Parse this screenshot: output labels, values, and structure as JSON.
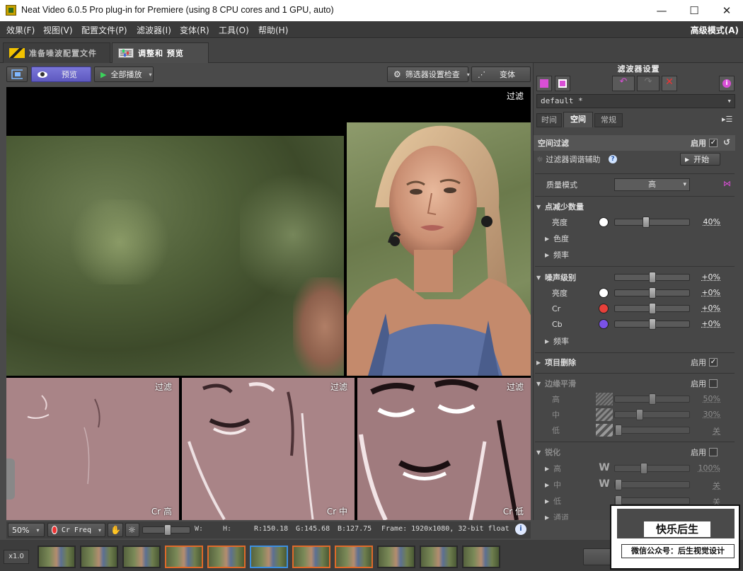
{
  "window": {
    "title": "Neat Video 6.0.5 Pro plug-in for Premiere (using 8 CPU cores and 1 GPU, auto)"
  },
  "menu": {
    "items": [
      "效果(F)",
      "视图(V)",
      "配置文件(P)",
      "滤波器(I)",
      "变体(R)",
      "工具(O)",
      "帮助(H)"
    ],
    "advanced_mode": "高级模式(A)"
  },
  "tabs": [
    {
      "label": "准备噪波配置文件",
      "active": false
    },
    {
      "label": "调整和 预览",
      "active": true
    }
  ],
  "toolbar": {
    "preview_label": "预览",
    "play_all_label": "全部播放",
    "filter_inspect_label": "筛选器设置检查",
    "variant_label": "变体"
  },
  "viewer": {
    "main_label": "过滤",
    "panes": [
      {
        "top": "过滤",
        "bottom": "Cr 高"
      },
      {
        "top": "过滤",
        "bottom": "Cr 中"
      },
      {
        "top": "过滤",
        "bottom": "Cr 低"
      }
    ]
  },
  "filter_panel": {
    "title": "滤波器设置",
    "profile": "default *",
    "subtabs": [
      "时间",
      "空间",
      "常规"
    ],
    "active_subtab": "空间",
    "spatial_filter": {
      "label": "空间过滤",
      "enable_label": "启用",
      "enabled": true
    },
    "assist": {
      "label": "过滤器调谐辅助",
      "button": "开始"
    },
    "quality": {
      "label": "质量模式",
      "value": "高"
    },
    "noise_reduction": {
      "label": "点减少数量",
      "luma": {
        "label": "亮度",
        "value": "40%",
        "level": 40
      },
      "chroma": "色度",
      "frequency": "频率"
    },
    "noise_level": {
      "label": "噪声级别",
      "value": "+0%",
      "rows": [
        {
          "label": "亮度",
          "value": "+0%",
          "color": "#ffffff"
        },
        {
          "label": "Cr",
          "value": "+0%",
          "color": "#e8403a"
        },
        {
          "label": "Cb",
          "value": "+0%",
          "color": "#7a52e8"
        }
      ],
      "frequency": "频率"
    },
    "artifact_removal": {
      "label": "项目删除",
      "enable_label": "启用",
      "enabled": true
    },
    "edge_smoothing": {
      "label": "边缘平滑",
      "enable_label": "启用",
      "enabled": false,
      "rows": [
        {
          "label": "高",
          "value": "50%"
        },
        {
          "label": "中",
          "value": "30%"
        },
        {
          "label": "低",
          "value": "关"
        }
      ]
    },
    "sharpening": {
      "label": "锐化",
      "enable_label": "启用",
      "enabled": false,
      "rows": [
        {
          "label": "高",
          "value": "100%"
        },
        {
          "label": "中",
          "value": "关"
        },
        {
          "label": "低",
          "value": "关"
        }
      ],
      "channel": "通道"
    }
  },
  "status": {
    "zoom": "50%",
    "freq_select": "Cr Freq",
    "w": "W:",
    "h": "H:",
    "r": "R:150.18",
    "g": "G:145.68",
    "b": "B:127.75",
    "frame": "Frame: 1920x1080, 32-bit float"
  },
  "filmstrip": {
    "speed": "x1.0"
  },
  "watermark": {
    "line1": "快乐后生",
    "line2": "微信公众号：后生视觉设计"
  }
}
